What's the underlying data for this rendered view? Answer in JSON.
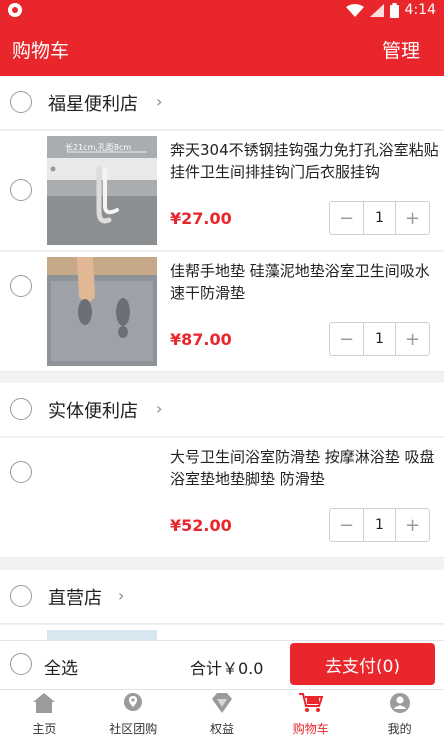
{
  "status_bar": {
    "time": "4:14"
  },
  "nav": {
    "title": "购物车",
    "manage": "管理"
  },
  "shops": [
    {
      "name": "福星便利店",
      "items": [
        {
          "name": "奔天304不锈钢挂钩强力免打孔浴室粘贴挂件卫生间排挂钩门后衣服挂钩",
          "price": "¥27.00",
          "qty": "1",
          "thumb_text": "长21cm,孔距8cm"
        },
        {
          "name": "佳帮手地垫 硅藻泥地垫浴室卫生间吸水速干防滑垫",
          "price": "¥87.00",
          "qty": "1"
        }
      ]
    },
    {
      "name": "实体便利店",
      "items": [
        {
          "name": "大号卫生间浴室防滑垫 按摩淋浴垫 吸盘浴室垫地垫脚垫 防滑垫",
          "price": "¥52.00",
          "qty": "1"
        }
      ]
    },
    {
      "name": "直营店",
      "items": []
    }
  ],
  "stepper": {
    "minus": "−",
    "plus": "+"
  },
  "bottom": {
    "select_all": "全选",
    "total": "合计￥0.0",
    "pay": "去支付(0)"
  },
  "tabs": [
    {
      "label": "主页",
      "icon": "home-icon"
    },
    {
      "label": "社区团购",
      "icon": "location-icon"
    },
    {
      "label": "权益",
      "icon": "gem-icon"
    },
    {
      "label": "购物车",
      "icon": "cart-icon",
      "active": true
    },
    {
      "label": "我的",
      "icon": "user-icon"
    }
  ],
  "colors": {
    "accent": "#e8262c",
    "background": "#f2f2f2"
  }
}
